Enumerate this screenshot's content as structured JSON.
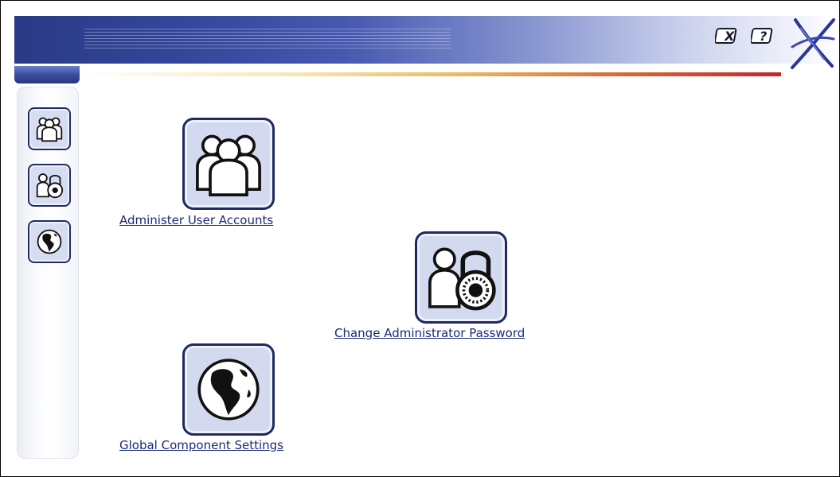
{
  "header": {
    "close_button_label": "X",
    "help_button_label": "?",
    "logo_icon": "x-star-logo-icon"
  },
  "sidebar": {
    "items": [
      {
        "name": "users",
        "icon": "users-group-icon"
      },
      {
        "name": "password",
        "icon": "user-lock-icon"
      },
      {
        "name": "global",
        "icon": "globe-icon"
      }
    ]
  },
  "main": {
    "entries": [
      {
        "label": "Administer User Accounts",
        "icon": "users-group-icon"
      },
      {
        "label": "Change Administrator Password",
        "icon": "user-lock-icon"
      },
      {
        "label": "Global Component Settings",
        "icon": "globe-icon"
      }
    ]
  },
  "colors": {
    "banner_dark": "#2a3a86",
    "link": "#1a2a7a",
    "icon_bg": "#d3daf0",
    "icon_border": "#1e2a60",
    "accent_red": "#c2262a"
  }
}
